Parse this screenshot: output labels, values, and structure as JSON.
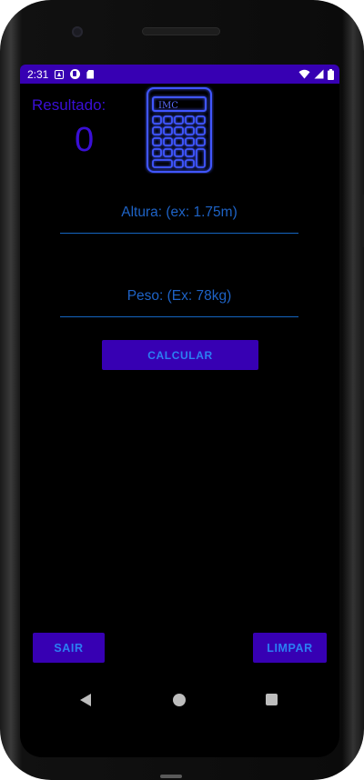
{
  "status_bar": {
    "time": "2:31",
    "icons": [
      "notification-a-icon",
      "notification-b-icon",
      "sd-card-icon",
      "wifi-icon",
      "signal-icon",
      "battery-icon"
    ],
    "background": "#3700b3"
  },
  "app": {
    "result_label": "Resultado:",
    "result_value": "0",
    "logo_text": "IMC",
    "height_field": {
      "placeholder": "Altura: (ex: 1.75m)",
      "value": ""
    },
    "weight_field": {
      "placeholder": "Peso: (Ex: 78kg)",
      "value": ""
    },
    "calculate_button": "CALCULAR",
    "exit_button": "SAIR",
    "clear_button": "LIMPAR",
    "colors": {
      "accent": "#3700b3",
      "text_blue": "#1e63c6",
      "result_purple": "#3a0fd6",
      "background": "#000000"
    }
  },
  "nav_bar": {
    "icons": [
      "back-icon",
      "home-icon",
      "recents-icon"
    ]
  }
}
